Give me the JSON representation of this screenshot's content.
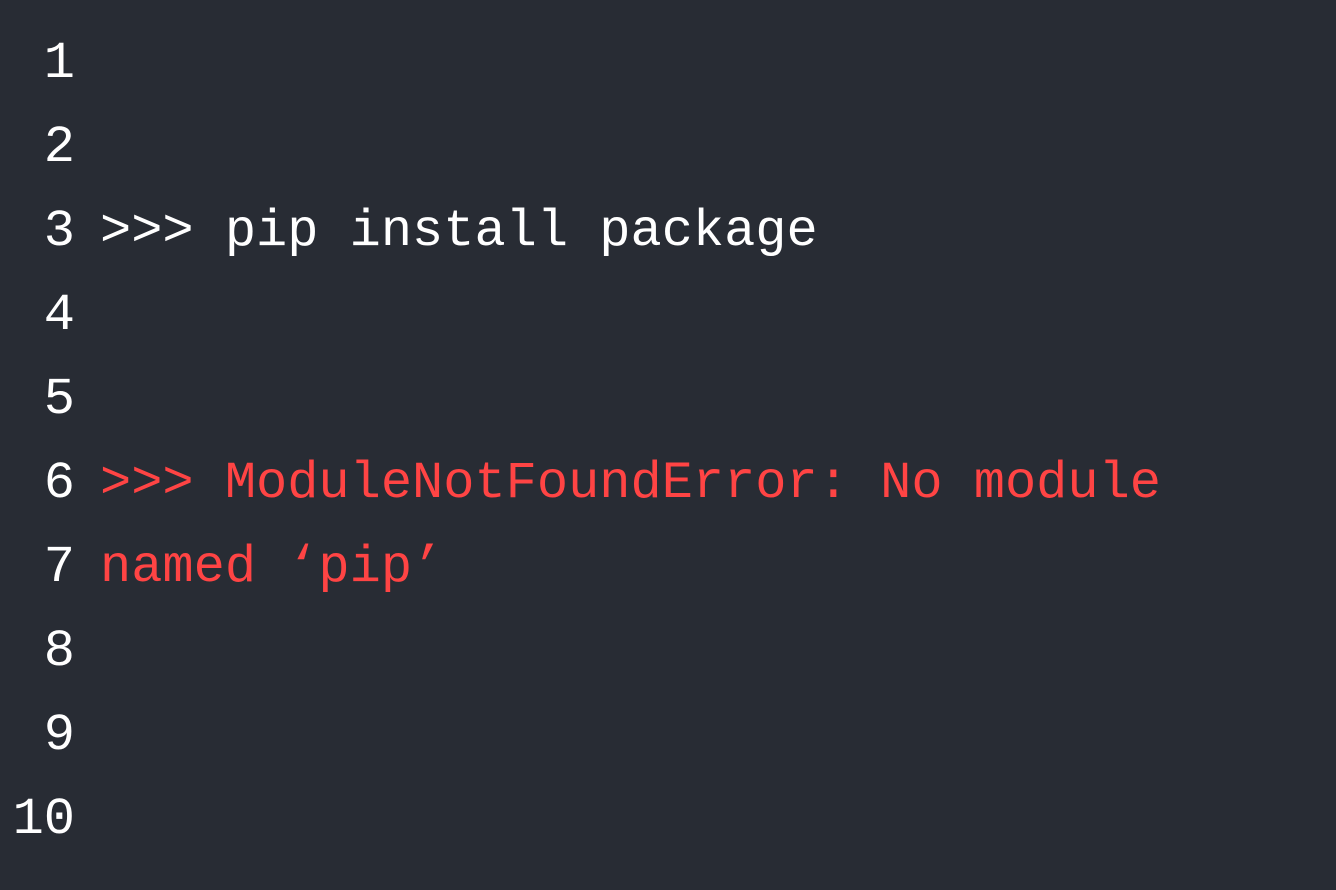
{
  "editor": {
    "line_numbers": [
      "1",
      "2",
      "3",
      "4",
      "5",
      "6",
      "7",
      "8",
      "9",
      "10"
    ],
    "lines": [
      {
        "text": "",
        "color": "white"
      },
      {
        "text": "",
        "color": "white"
      },
      {
        "text": ">>> pip install package",
        "color": "white"
      },
      {
        "text": "",
        "color": "white"
      },
      {
        "text": "",
        "color": "white"
      },
      {
        "text": ">>> ModuleNotFoundError: No module named ‘pip’",
        "color": "red",
        "span_rows": 2
      },
      {
        "text": "",
        "color": "white"
      },
      {
        "text": "",
        "color": "white"
      },
      {
        "text": "",
        "color": "white"
      }
    ],
    "colors": {
      "background": "#282c34",
      "text_white": "#ffffff",
      "text_error": "#ff4444"
    }
  }
}
